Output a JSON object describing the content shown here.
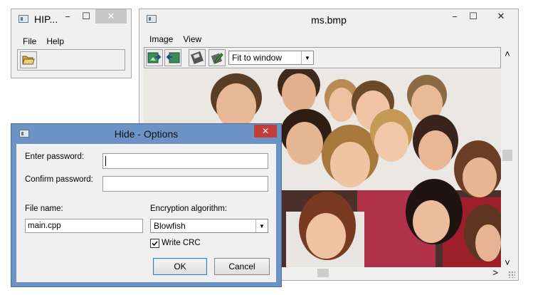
{
  "small_window": {
    "title": "HIP...",
    "controls": {
      "minimize": "−",
      "maximize": "☐",
      "close": "✕"
    },
    "menu": [
      "File",
      "Help"
    ],
    "toolbar": {
      "open_icon": "folder-open-icon"
    }
  },
  "image_window": {
    "title": "ms.bmp",
    "controls": {
      "minimize": "−",
      "maximize": "☐",
      "close": "✕"
    },
    "menu": [
      "Image",
      "View"
    ],
    "toolbar": {
      "icons": [
        "hide-data-icon",
        "extract-data-icon",
        "save-icon",
        "edit-icon"
      ],
      "zoom_select": "Fit to window"
    },
    "image_description_icon": "photo-group-of-smiling-people",
    "scroll": {
      "up": "˄",
      "down": "˅",
      "right": "˃"
    }
  },
  "dialog": {
    "title": "Hide - Options",
    "close": "✕",
    "labels": {
      "enter_password": "Enter password:",
      "confirm_password": "Confirm password:",
      "file_name": "File name:",
      "encryption": "Encryption algorithm:"
    },
    "fields": {
      "enter_password": "",
      "confirm_password": "",
      "file_name": "main.cpp"
    },
    "encryption_value": "Blowfish",
    "write_crc": {
      "label": "Write CRC",
      "checked": true
    },
    "buttons": {
      "ok": "OK",
      "cancel": "Cancel"
    }
  },
  "colors": {
    "dialog_frame": "#6b93c4",
    "close_red": "#c43c3c",
    "window_bg": "#f0f0f0"
  }
}
